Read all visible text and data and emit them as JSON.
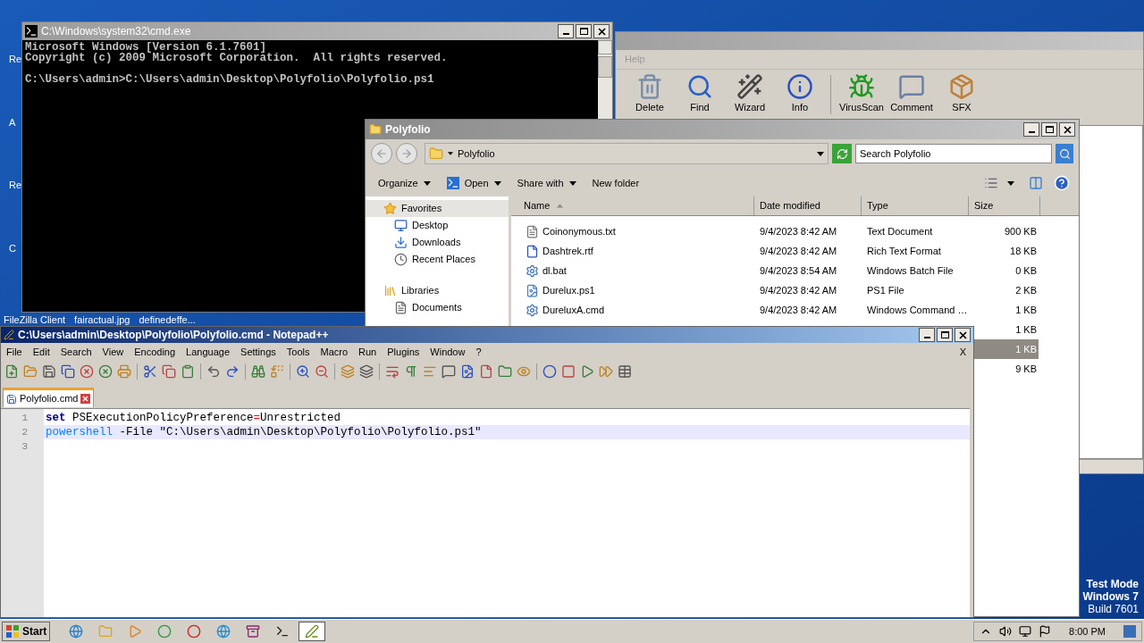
{
  "desktop": {
    "icon_labels": [
      "Re",
      "A",
      "Re",
      "C"
    ],
    "bottom_labels": [
      "FileZilla Client",
      "fairactual.jpg",
      "definedeffe..."
    ],
    "watermark_text": [
      "Test Mode",
      "Windows 7",
      "Build 7601"
    ]
  },
  "winrar": {
    "menu": [
      "Help"
    ],
    "toolbar": [
      {
        "label": "Delete",
        "kind": "trash"
      },
      {
        "label": "Find",
        "kind": "find"
      },
      {
        "label": "Wizard",
        "kind": "wand"
      },
      {
        "label": "Info",
        "kind": "info"
      },
      {
        "label": "VirusScan",
        "kind": "bug"
      },
      {
        "label": "Comment",
        "kind": "comment"
      },
      {
        "label": "SFX",
        "kind": "box"
      }
    ]
  },
  "cmd": {
    "title": "C:\\Windows\\system32\\cmd.exe",
    "lines": [
      {
        "kind": "text",
        "text": "Microsoft Windows [Version 6.1.7601]"
      },
      {
        "kind": "text",
        "text": "Copyright (c) 2009 Microsoft Corporation.  All rights reserved."
      },
      {
        "kind": "blank"
      },
      {
        "kind": "text",
        "text": "C:\\Users\\admin>C:\\Users\\admin\\Desktop\\Polyfolio\\Polyfolio.ps1"
      }
    ]
  },
  "explorer": {
    "title": "Polyfolio",
    "address": "Polyfolio",
    "search": {
      "placeholder": "Search Polyfolio"
    },
    "commands": [
      {
        "label": "Organize",
        "dropdown": true
      },
      {
        "label": "Open",
        "dropdown": true
      },
      {
        "label": "Share with",
        "dropdown": true
      },
      {
        "label": "New folder",
        "dropdown": false
      }
    ],
    "nav": [
      {
        "label": "Favorites",
        "kind": "star",
        "selected": true,
        "children": [
          {
            "label": "Desktop",
            "kind": "desktop",
            "selected": false
          },
          {
            "label": "Downloads",
            "kind": "downloads",
            "selected": false
          },
          {
            "label": "Recent Places",
            "kind": "recent",
            "selected": false
          }
        ]
      },
      {
        "label": "Libraries",
        "kind": "library",
        "selected": false,
        "children": [
          {
            "label": "Documents",
            "kind": "document",
            "selected": false
          }
        ]
      }
    ],
    "columns": [
      "Name",
      "Date modified",
      "Type",
      "Size"
    ],
    "files": [
      {
        "name": "Coinonymous.txt",
        "date": "9/4/2023 8:42 AM",
        "type": "Text Document",
        "size": "900 KB",
        "kind": "text",
        "selected": false
      },
      {
        "name": "Dashtrek.rtf",
        "date": "9/4/2023 8:42 AM",
        "type": "Rich Text Format",
        "size": "18 KB",
        "kind": "word",
        "selected": false
      },
      {
        "name": "dl.bat",
        "date": "9/4/2023 8:54 AM",
        "type": "Windows Batch File",
        "size": "0 KB",
        "kind": "script",
        "selected": false
      },
      {
        "name": "Durelux.ps1",
        "date": "9/4/2023 8:42 AM",
        "type": "PS1 File",
        "size": "2 KB",
        "kind": "image",
        "selected": false
      },
      {
        "name": "DureluxA.cmd",
        "date": "9/4/2023 8:42 AM",
        "type": "Windows Command …",
        "size": "1 KB",
        "kind": "script",
        "selected": false
      },
      {
        "size": "1 KB",
        "selected": false
      },
      {
        "size": "1 KB",
        "selected": true
      },
      {
        "size": "9 KB",
        "selected": false
      }
    ]
  },
  "notepad": {
    "title": "C:\\Users\\admin\\Desktop\\Polyfolio\\Polyfolio.cmd - Notepad++",
    "menu": [
      "File",
      "Edit",
      "Search",
      "View",
      "Encoding",
      "Language",
      "Settings",
      "Tools",
      "Macro",
      "Run",
      "Plugins",
      "Window",
      "?"
    ],
    "close_doc": "X",
    "tabs": [
      {
        "label": "Polyfolio.cmd",
        "selected": true
      }
    ],
    "lines": [
      {
        "number": "1",
        "current": false,
        "tokens": [
          {
            "text": "set",
            "kind": "keyword"
          },
          {
            "text": " PSExecutionPolicyPreference",
            "kind": "text"
          },
          {
            "text": "=",
            "kind": "operator"
          },
          {
            "text": "Unrestricted",
            "kind": "text"
          }
        ]
      },
      {
        "number": "2",
        "current": true,
        "tokens": [
          {
            "text": "powershell",
            "kind": "command"
          },
          {
            "text": " -File \"C:\\Users\\admin\\Desktop\\Polyfolio\\Polyfolio.ps1\"",
            "kind": "text"
          }
        ]
      },
      {
        "number": "3",
        "current": false
      }
    ]
  },
  "taskbar": {
    "start": "Start",
    "apps": [
      {
        "kind": "ie",
        "selected": false
      },
      {
        "kind": "folder",
        "selected": false
      },
      {
        "kind": "media",
        "selected": false
      },
      {
        "kind": "chrome",
        "selected": false
      },
      {
        "kind": "opera",
        "selected": false
      },
      {
        "kind": "edge",
        "selected": false
      },
      {
        "kind": "winrar",
        "selected": false
      },
      {
        "kind": "cmd",
        "selected": false
      },
      {
        "kind": "notepad",
        "selected": true
      }
    ],
    "clock": "8:00 PM"
  }
}
